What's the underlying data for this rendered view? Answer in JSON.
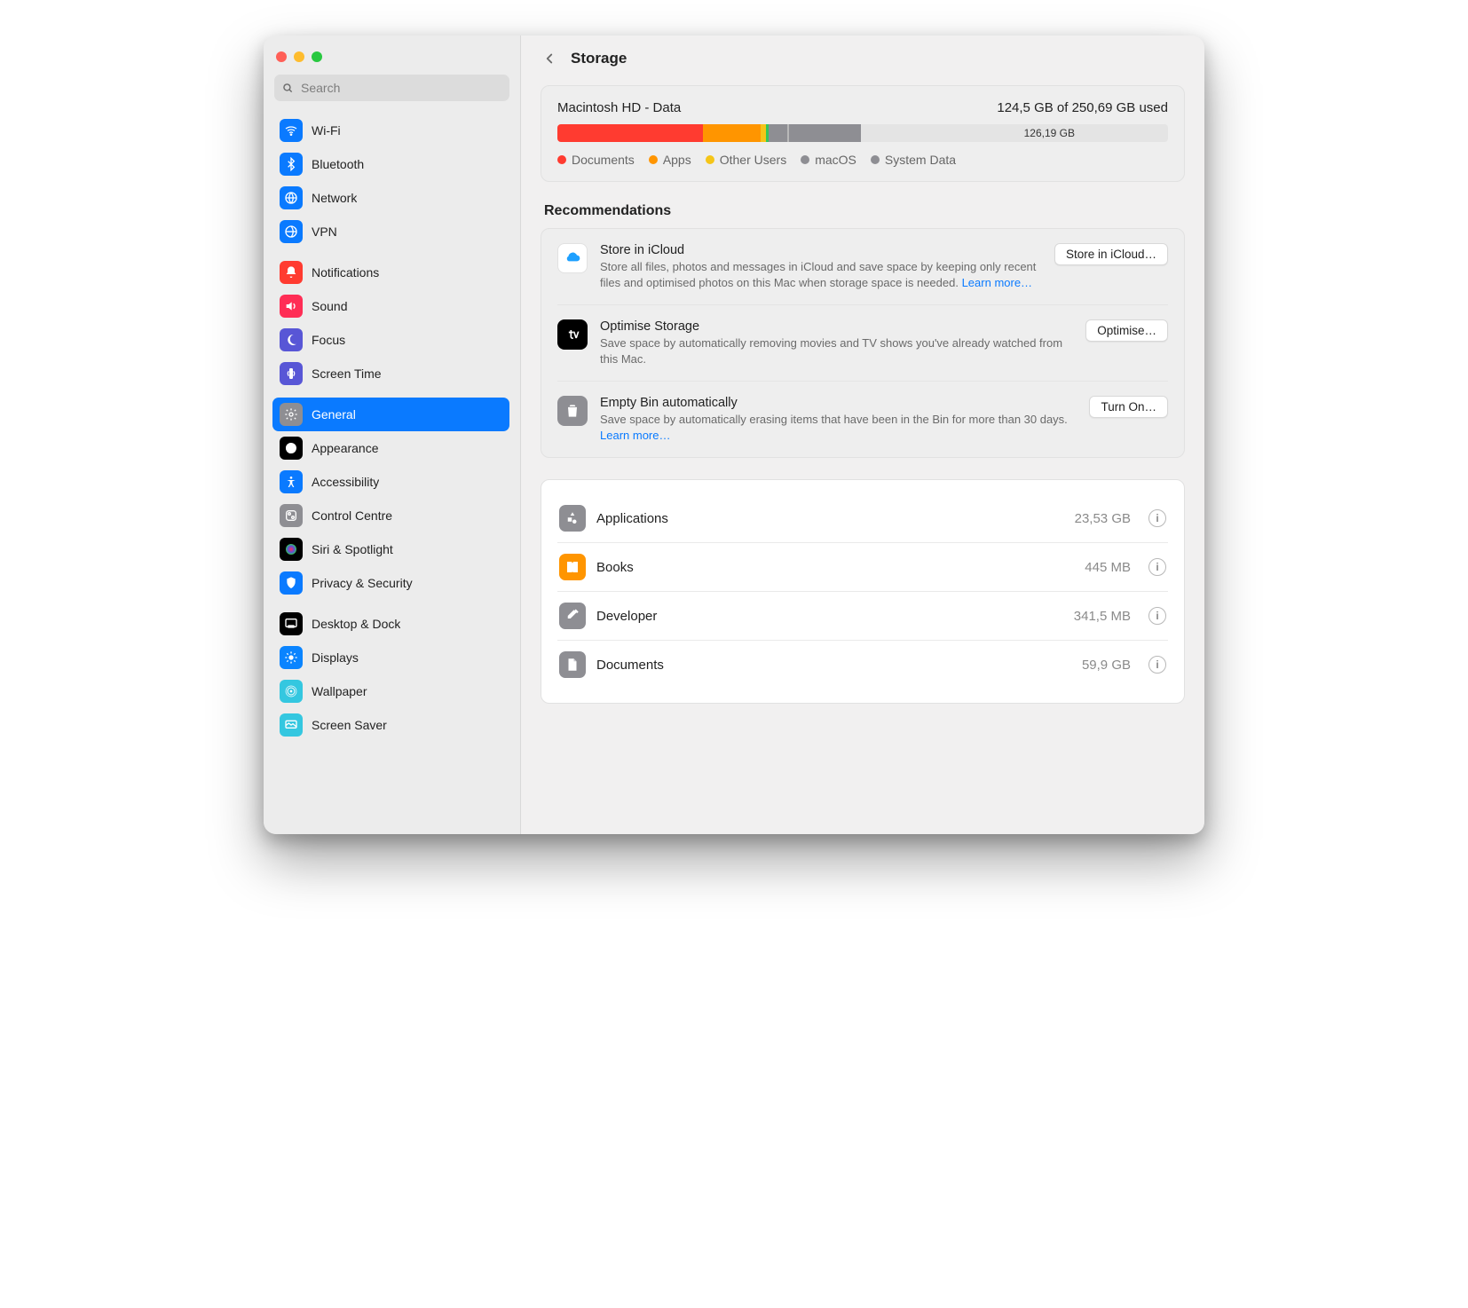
{
  "colors": {
    "accent": "#0a7aff",
    "red": "#ff3b30",
    "orange": "#ff9500",
    "yellow": "#f5c518",
    "green": "#34c759",
    "gray": "#8e8e93",
    "bar_free": "#e4e4e4"
  },
  "search": {
    "placeholder": "Search"
  },
  "header": {
    "title": "Storage"
  },
  "sidebar": {
    "groups": [
      {
        "items": [
          {
            "label": "Wi-Fi",
            "icon": "wifi-icon",
            "color": "#0a7aff"
          },
          {
            "label": "Bluetooth",
            "icon": "bluetooth-icon",
            "color": "#0a7aff"
          },
          {
            "label": "Network",
            "icon": "network-icon",
            "color": "#0a7aff"
          },
          {
            "label": "VPN",
            "icon": "vpn-icon",
            "color": "#0a7aff"
          }
        ]
      },
      {
        "items": [
          {
            "label": "Notifications",
            "icon": "notifications-icon",
            "color": "#ff3b30"
          },
          {
            "label": "Sound",
            "icon": "sound-icon",
            "color": "#ff2d55"
          },
          {
            "label": "Focus",
            "icon": "focus-icon",
            "color": "#5856d6"
          },
          {
            "label": "Screen Time",
            "icon": "screentime-icon",
            "color": "#5856d6"
          }
        ]
      },
      {
        "items": [
          {
            "label": "General",
            "icon": "general-icon",
            "color": "#8e8e93",
            "selected": true
          },
          {
            "label": "Appearance",
            "icon": "appearance-icon",
            "color": "#000000"
          },
          {
            "label": "Accessibility",
            "icon": "accessibility-icon",
            "color": "#0a7aff"
          },
          {
            "label": "Control Centre",
            "icon": "controlcentre-icon",
            "color": "#8e8e93"
          },
          {
            "label": "Siri & Spotlight",
            "icon": "siri-icon",
            "color": "#000000"
          },
          {
            "label": "Privacy & Security",
            "icon": "privacy-icon",
            "color": "#0a7aff"
          }
        ]
      },
      {
        "items": [
          {
            "label": "Desktop & Dock",
            "icon": "dock-icon",
            "color": "#000000"
          },
          {
            "label": "Displays",
            "icon": "displays-icon",
            "color": "#0a84ff"
          },
          {
            "label": "Wallpaper",
            "icon": "wallpaper-icon",
            "color": "#34c7e0"
          },
          {
            "label": "Screen Saver",
            "icon": "screensaver-icon",
            "color": "#34c7e0"
          }
        ]
      }
    ]
  },
  "disk": {
    "name": "Macintosh HD - Data",
    "used_text": "124,5 GB of 250,69 GB used",
    "free_text": "126,19 GB",
    "segments": [
      {
        "label": "Documents",
        "color": "#ff3b30",
        "percent": 23.9
      },
      {
        "label": "Apps",
        "color": "#ff9500",
        "percent": 9.4
      },
      {
        "label": "Other Users",
        "color": "#f5c518",
        "percent": 0.8
      },
      {
        "label": "green-seg",
        "color": "#34c759",
        "percent": 0.5,
        "hidden_legend": true
      },
      {
        "label": "macOS",
        "color": "#8e8e93",
        "percent": 3.0
      },
      {
        "label": "gap",
        "color": "#b8b8b8",
        "percent": 0.4,
        "hidden_legend": true
      },
      {
        "label": "System Data",
        "color": "#8e8e93",
        "percent": 11.7
      }
    ]
  },
  "recommendations_title": "Recommendations",
  "recommendations": [
    {
      "icon": "icloud-icon",
      "icon_bg": "#ffffff",
      "icon_fg": "#1ea0ff",
      "icon_border": "#e1e1e1",
      "title": "Store in iCloud",
      "desc": "Store all files, photos and messages in iCloud and save space by keeping only recent files and optimised photos on this Mac when storage space is needed. ",
      "learn_more": "Learn more…",
      "action": "Store in iCloud…"
    },
    {
      "icon": "appletv-icon",
      "icon_bg": "#000000",
      "title": "Optimise Storage",
      "desc": "Save space by automatically removing movies and TV shows you've already watched from this Mac.",
      "action": "Optimise…"
    },
    {
      "icon": "trash-icon",
      "icon_bg": "#8e8e93",
      "title": "Empty Bin automatically",
      "desc": "Save space by automatically erasing items that have been in the Bin for more than 30 days. ",
      "learn_more": "Learn more…",
      "action": "Turn On…"
    }
  ],
  "categories": [
    {
      "icon": "apps-icon",
      "color": "#8e8e93",
      "name": "Applications",
      "size": "23,53 GB"
    },
    {
      "icon": "books-icon",
      "color": "#ff9500",
      "name": "Books",
      "size": "445 MB"
    },
    {
      "icon": "developer-icon",
      "color": "#8e8e93",
      "name": "Developer",
      "size": "341,5 MB"
    },
    {
      "icon": "documents-icon",
      "color": "#8e8e93",
      "name": "Documents",
      "size": "59,9 GB"
    }
  ]
}
